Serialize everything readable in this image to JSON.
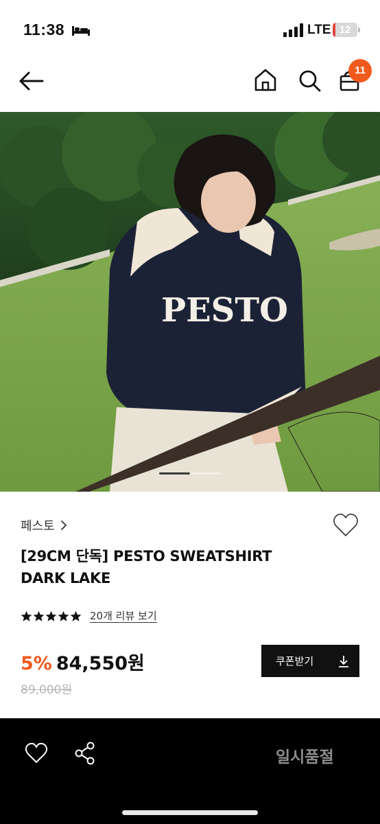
{
  "status_bar": {
    "time": "11:38",
    "network": "LTE",
    "battery": "12",
    "battery_level_percent": 12,
    "icons": [
      "bed-icon",
      "signal-icon",
      "battery-icon"
    ]
  },
  "header": {
    "icons": [
      "back-arrow-icon",
      "home-icon",
      "search-icon",
      "cart-icon"
    ],
    "cart_count": "11"
  },
  "hero": {
    "description_icon": "product-photo",
    "sweatshirt_print": "PESTO",
    "carousel": {
      "active_index": 1
    }
  },
  "product": {
    "brand": "페스토",
    "title_line1": "[29CM 단독] PESTO SWEATSHIRT",
    "title_line2": "DARK LAKE",
    "rating_stars": 5,
    "review_link": "20개 리뷰 보기",
    "discount": "5%",
    "price": "84,550원",
    "original_price": "89,000원",
    "coupon_button": "쿠폰받기"
  },
  "bottom_bar": {
    "status": "일시품절"
  },
  "colors": {
    "accent": "#f15a1e",
    "dark": "#111111",
    "muted": "#8e8e8e"
  }
}
